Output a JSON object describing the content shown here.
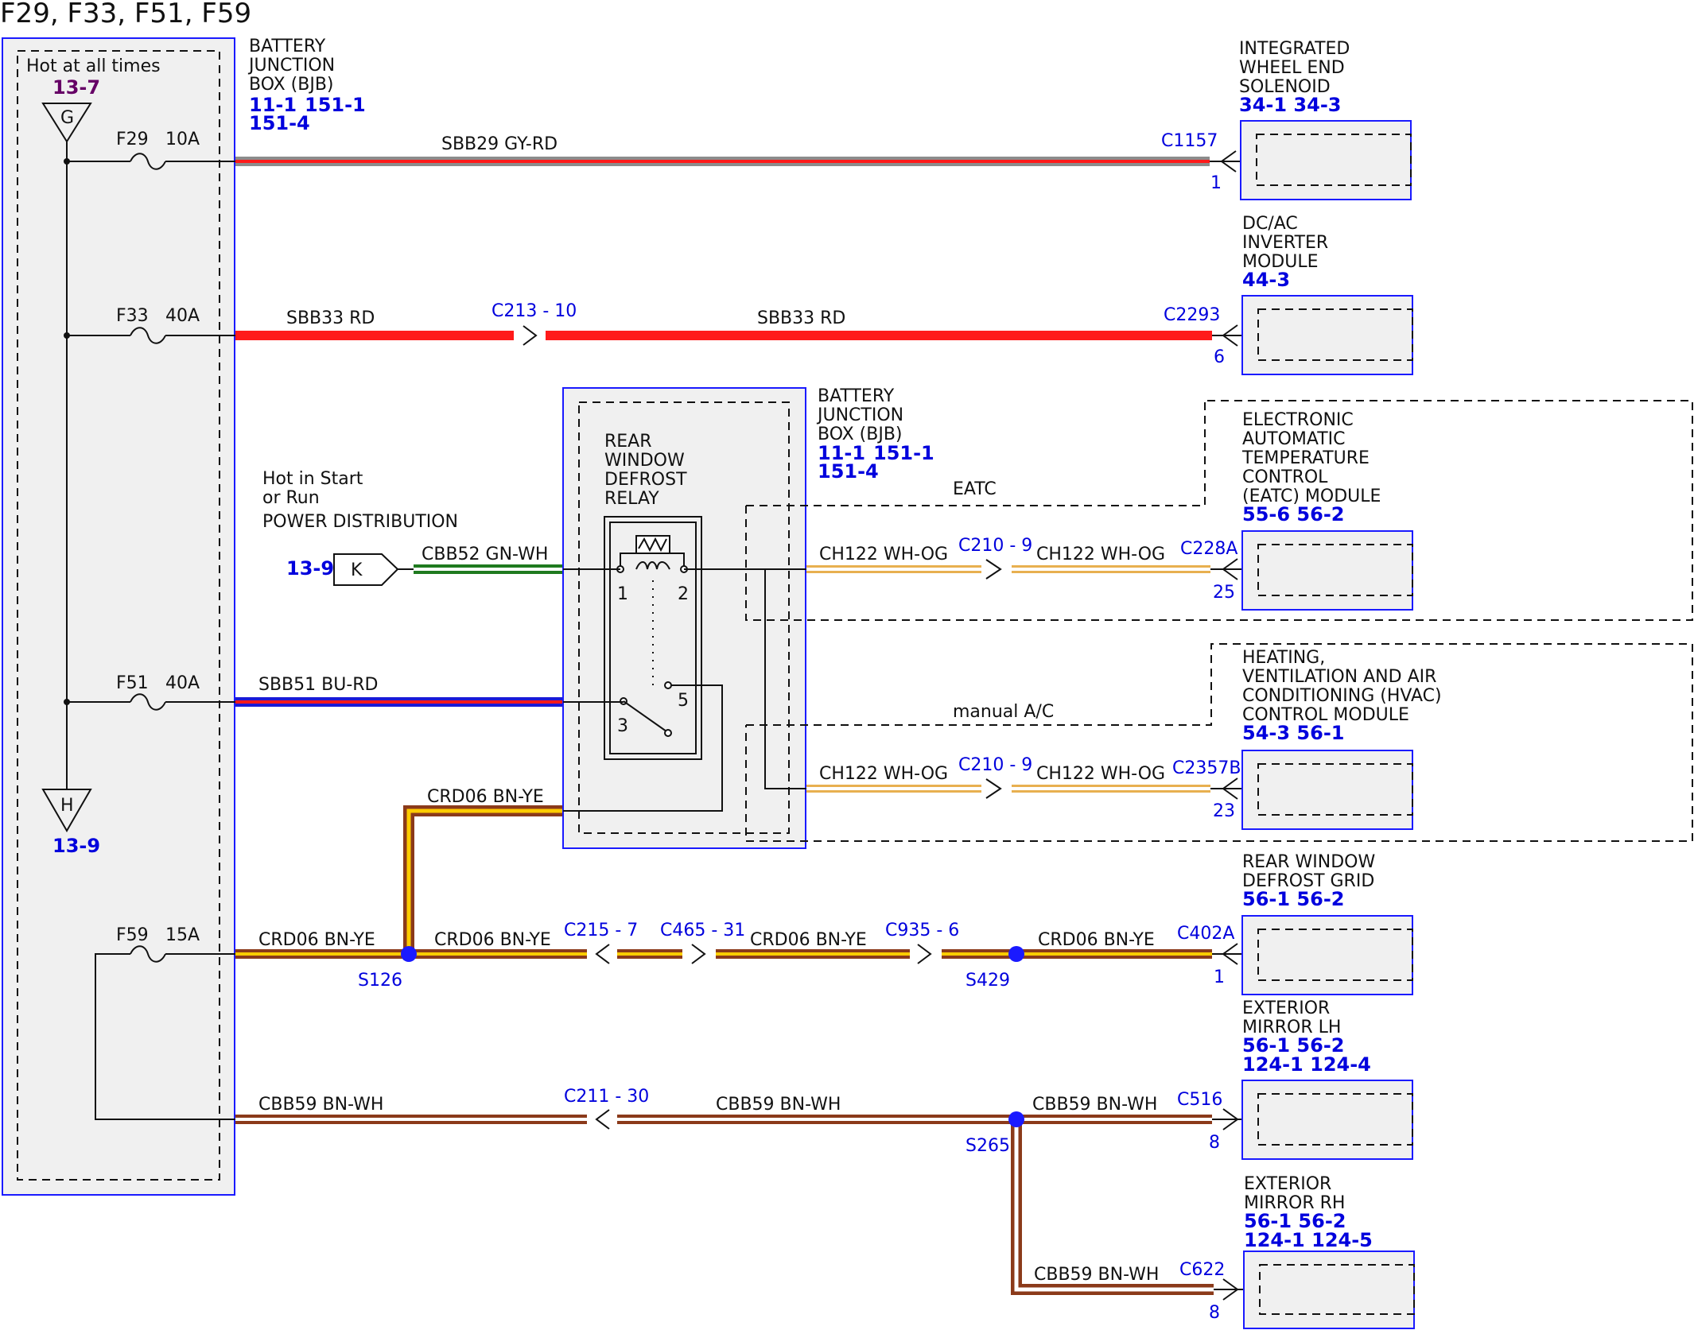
{
  "title": "F29, F33, F51, F59",
  "bjb": {
    "name": "BATTERY JUNCTION BOX (BJB)",
    "refs": [
      "11-1",
      "151-1",
      "151-4"
    ],
    "hot_label": "Hot at all times",
    "g_ref": "13-7",
    "g_letter": "G",
    "h_letter": "H",
    "h_ref": "13-9"
  },
  "fuses": [
    {
      "id": "F29",
      "amps": "10A"
    },
    {
      "id": "F33",
      "amps": "40A"
    },
    {
      "id": "F51",
      "amps": "40A"
    },
    {
      "id": "F59",
      "amps": "15A"
    }
  ],
  "relay_box": {
    "name": "BATTERY JUNCTION BOX (BJB)",
    "refs": [
      "11-1",
      "151-1",
      "151-4"
    ],
    "relay_name": "REAR WINDOW DEFROST RELAY",
    "pins": [
      "1",
      "2",
      "3",
      "5"
    ]
  },
  "hot_start": {
    "line1": "Hot in Start",
    "line2": "or Run",
    "line3": "POWER DISTRIBUTION",
    "ref": "13-9",
    "letter": "K"
  },
  "wires": {
    "sbb29": "SBB29  GY-RD",
    "sbb33": "SBB33  RD",
    "cbb52": "CBB52  GN-WH",
    "sbb51": "SBB51  BU-RD",
    "ch122": "CH122  WH-OG",
    "crd06": "CRD06  BN-YE",
    "cbb59": "CBB59  BN-WH"
  },
  "connectors": {
    "c1157": "C1157",
    "c213": "C213 - 10",
    "c2293": "C2293",
    "c210a": "C210 - 9",
    "c228a": "C228A",
    "c210b": "C210 - 9",
    "c2357b": "C2357B",
    "c215": "C215 - 7",
    "c465": "C465 - 31",
    "c935": "C935 - 6",
    "c402a": "C402A",
    "c211": "C211 - 30",
    "c516": "C516",
    "c622": "C622"
  },
  "splices": {
    "s126": "S126",
    "s429": "S429",
    "s265": "S265"
  },
  "pins": {
    "p1157": "1",
    "p2293": "6",
    "p228a": "25",
    "p2357b": "23",
    "p402a": "1",
    "p516": "8",
    "p622": "8"
  },
  "option_labels": {
    "eatc": "EATC",
    "manual": "manual A/C"
  },
  "components": [
    {
      "lines": [
        "INTEGRATED",
        "WHEEL END",
        "SOLENOID"
      ],
      "refs": [
        "34-1  34-3"
      ]
    },
    {
      "lines": [
        "DC/AC",
        "INVERTER",
        "MODULE"
      ],
      "refs": [
        "44-3"
      ]
    },
    {
      "lines": [
        "ELECTRONIC",
        "AUTOMATIC",
        "TEMPERATURE",
        "CONTROL",
        "(EATC) MODULE"
      ],
      "refs": [
        "55-6  56-2"
      ]
    },
    {
      "lines": [
        "HEATING,",
        "VENTILATION AND AIR",
        "CONDITIONING (HVAC)",
        "CONTROL MODULE"
      ],
      "refs": [
        "54-3  56-1"
      ]
    },
    {
      "lines": [
        "REAR WINDOW",
        "DEFROST GRID"
      ],
      "refs": [
        "56-1  56-2"
      ]
    },
    {
      "lines": [
        "EXTERIOR",
        "MIRROR LH"
      ],
      "refs": [
        "56-1  56-2",
        "124-1 124-4"
      ]
    },
    {
      "lines": [
        "EXTERIOR",
        "MIRROR RH"
      ],
      "refs": [
        "56-1  56-2",
        "124-1 124-5"
      ]
    }
  ],
  "colors": {
    "block_border": "#1a1aff",
    "block_fill": "#f0f0f0",
    "ref_blue": "#0000dd",
    "ref_purple": "#660066",
    "gy": "#8c8c8c",
    "rd": "#ff1a1a",
    "gn": "#1f7a1f",
    "wh": "#ffffff",
    "bu": "#1a1ad6",
    "og": "#e8b050",
    "bn": "#8b3a1a",
    "ye": "#ffcc00"
  }
}
